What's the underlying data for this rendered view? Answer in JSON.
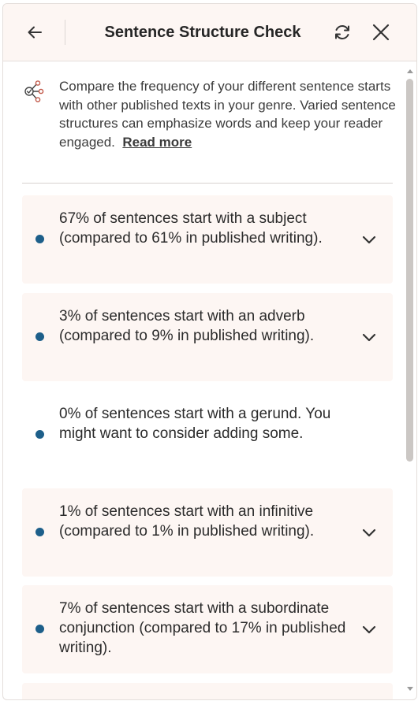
{
  "header": {
    "title": "Sentence Structure Check",
    "icons": [
      "arrow-left-icon",
      "refresh-icon",
      "close-icon"
    ]
  },
  "intro": {
    "icon": "sentence-structure-icon",
    "text": "Compare the frequency of your different sentence starts with other published texts in your genre. Varied sentence structures can emphasize words and keep your reader engaged.",
    "read_more": "Read more"
  },
  "items": [
    {
      "text": "67% of sentences start with a subject (compared to 61% in published writing).",
      "expandable": true
    },
    {
      "text": "3% of sentences start with an adverb (compared to 9% in published writing).",
      "expandable": true
    },
    {
      "text": "0% of sentences start with a gerund. You might want to consider adding some.",
      "expandable": false
    },
    {
      "text": "1% of sentences start with an infinitive (compared to 1% in published writing).",
      "expandable": true
    },
    {
      "text": "7% of sentences start with a subordinate conjunction (compared to 17% in published writing).",
      "expandable": true
    }
  ],
  "colors": {
    "header_bg": "#fdf6f3",
    "card_bg": "#fdf6f3",
    "bullet": "#1d5f8a",
    "text": "#2b2b2b",
    "border": "#e4dedb"
  }
}
